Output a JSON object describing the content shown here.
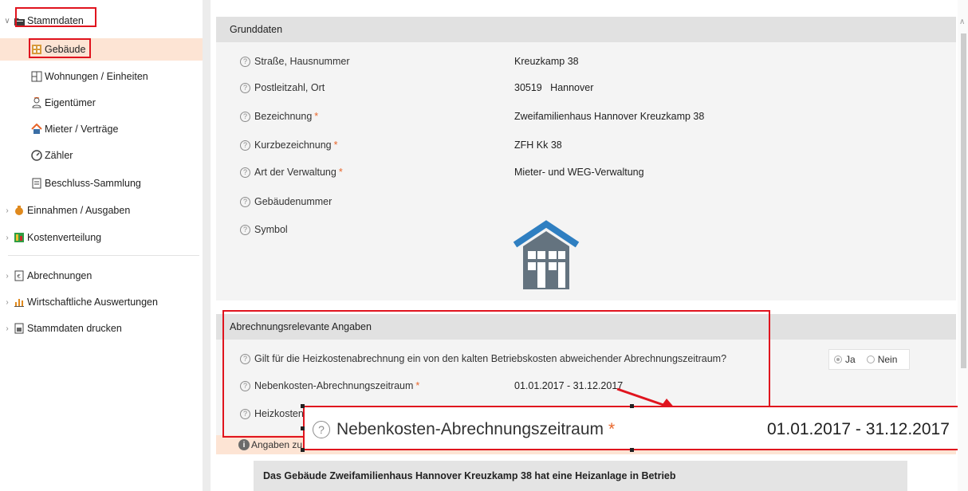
{
  "sidebar": {
    "stammdaten": "Stammdaten",
    "children": [
      {
        "label": "Gebäude"
      },
      {
        "label": "Wohnungen / Einheiten"
      },
      {
        "label": "Eigentümer"
      },
      {
        "label": "Mieter / Verträge"
      },
      {
        "label": "Zähler"
      },
      {
        "label": "Beschluss-Sammlung"
      }
    ],
    "einnahmen": "Einnahmen / Ausgaben",
    "kostenverteilung": "Kostenverteilung",
    "abrechnungen": "Abrechnungen",
    "wirtschaftliche": "Wirtschaftliche Auswertungen",
    "drucken": "Stammdaten drucken"
  },
  "grunddaten": {
    "title": "Grunddaten",
    "fields": [
      {
        "label": "Straße, Hausnummer",
        "value": "Kreuzkamp 38",
        "required": false
      },
      {
        "label": "Postleitzahl, Ort",
        "value": "30519   Hannover",
        "required": false
      },
      {
        "label": "Bezeichnung",
        "value": "Zweifamilienhaus Hannover Kreuzkamp 38",
        "required": true
      },
      {
        "label": "Kurzbezeichnung",
        "value": "ZFH Kk 38",
        "required": true
      },
      {
        "label": "Art der Verwaltung",
        "value": "Mieter- und WEG-Verwaltung",
        "required": true
      },
      {
        "label": "Gebäudenummer",
        "value": "",
        "required": false
      },
      {
        "label": "Symbol",
        "value": "",
        "required": false
      }
    ]
  },
  "abrechnung": {
    "title": "Abrechnungsrelevante Angaben",
    "question": "Gilt für die Heizkostenabrechnung ein von den kalten Betriebskosten abweichender Abrechnungszeitraum?",
    "radio_ja": "Ja",
    "radio_nein": "Nein",
    "radio_selected": "Ja",
    "nebenkosten_label": "Nebenkosten-Abrechnungszeitraum",
    "nebenkosten_value": "01.01.2017 - 31.12.2017",
    "heizkosten_label": "Heizkosten-"
  },
  "info": {
    "angaben_label": "Angaben zu",
    "heizung_text": "Das Gebäude Zweifamilienhaus Hannover Kreuzkamp 38 hat eine Heizanlage in Betrieb"
  },
  "callout": {
    "label": "Nebenkosten-Abrechnungszeitraum",
    "value": "01.01.2017 - 31.12.2017"
  },
  "required_mark": "*",
  "help_mark": "?",
  "colors": {
    "accent_red": "#e0141e",
    "selection": "#fde4d4",
    "required": "#e8662b",
    "house_roof": "#2f7fc1",
    "house_body": "#64737f"
  }
}
